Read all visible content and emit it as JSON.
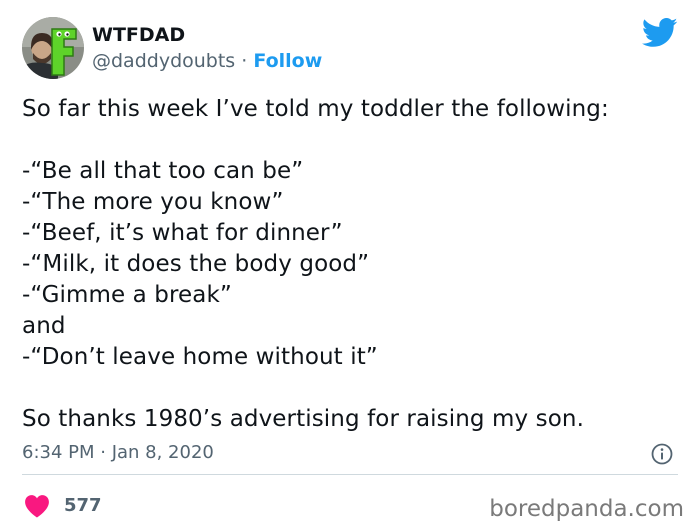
{
  "author": {
    "display_name": "WTFDAD",
    "handle": "@daddydoubts",
    "separator": "·",
    "follow_label": "Follow",
    "avatar_letter": "F"
  },
  "tweet": {
    "lines": [
      "So far this week I’ve told my toddler the following:",
      "",
      "-“Be all that too can be”",
      "-“The more you know”",
      "-“Beef, it’s what for dinner”",
      "-“Milk, it does the body good”",
      "-“Gimme a break”",
      "and",
      "-“Don’t leave home without it”",
      "",
      "So thanks 1980’s advertising for raising my son."
    ],
    "timestamp": "6:34 PM · Jan 8, 2020"
  },
  "engagement": {
    "likes": "577"
  },
  "watermark": "boredpanda.com",
  "colors": {
    "twitter_blue": "#1d9bf0",
    "heart_red": "#f91880",
    "secondary_text": "#536471",
    "avatar_green": "#5ed32a"
  },
  "icons": {
    "brand": "twitter-bird-icon",
    "info": "info-icon",
    "like": "heart-icon"
  }
}
